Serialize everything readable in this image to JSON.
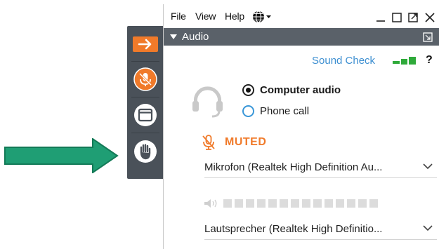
{
  "menu": {
    "file": "File",
    "view": "View",
    "help": "Help"
  },
  "audio_panel": {
    "title": "Audio",
    "sound_check": "Sound Check",
    "help": "?",
    "options": [
      {
        "label": "Computer audio",
        "selected": true
      },
      {
        "label": "Phone call",
        "selected": false
      }
    ],
    "muted_label": "MUTED",
    "microphone_value": "Mikrofon (Realtek High Definition Au...",
    "speaker_value": "Lautsprecher (Realtek High Definitio...",
    "speaker_level_segments": 14,
    "speaker_level_lit": 0
  },
  "toolbar": {
    "icons": [
      "arrow-right-icon",
      "microphone-muted-icon",
      "window-icon",
      "raise-hand-icon"
    ]
  },
  "colors": {
    "accent_orange": "#f07a2a",
    "toolbar_bg": "#4a5159",
    "header_bg": "#5a6169",
    "link_blue": "#3d8fd1",
    "signal_green": "#2faa3a",
    "arrow_green": "#1f9e74"
  }
}
